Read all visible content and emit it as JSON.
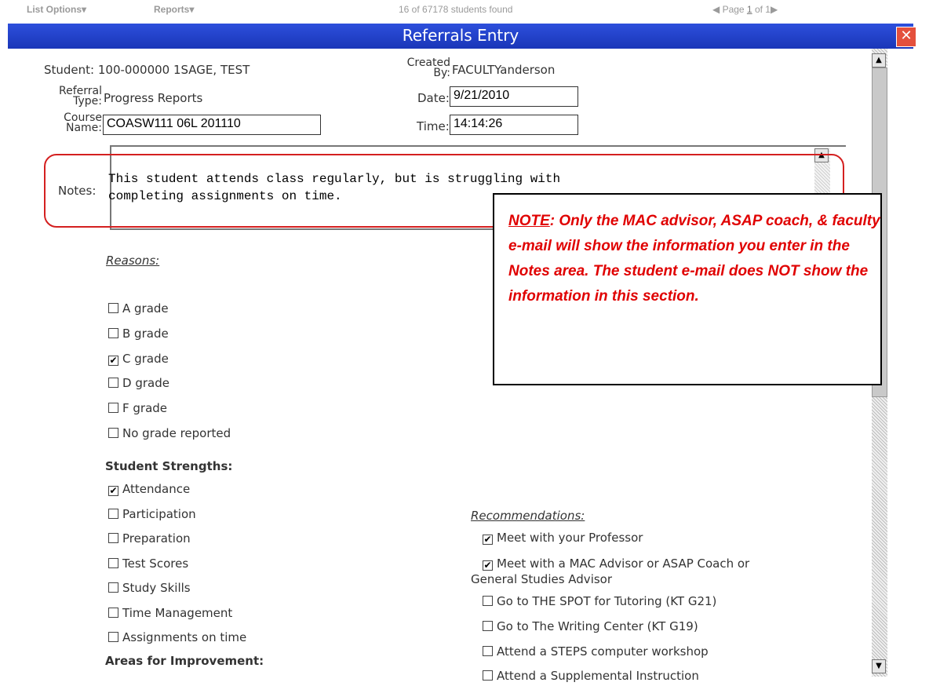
{
  "topbar": {
    "list_options": "List Options▾",
    "reports": "Reports▾",
    "found": "16 of 67178 students found",
    "page_prefix": "◀ Page ",
    "page_num": "1",
    "page_suffix": " of 1▶"
  },
  "window": {
    "title": "Referrals Entry",
    "close_glyph": "✕"
  },
  "form": {
    "student_label": "Student:",
    "student_value": "100-000000 1SAGE, TEST",
    "created_by_label_1": "Created",
    "created_by_label_2": "By:",
    "created_by_value": "FACULTYanderson",
    "referral_type_label_1": "Referral",
    "referral_type_label_2": "Type:",
    "referral_type_value": "Progress Reports",
    "date_label": "Date:",
    "date_value": "9/21/2010",
    "course_name_label_1": "Course",
    "course_name_label_2": "Name:",
    "course_name_value": "COASW111 06L 201110",
    "time_label": "Time:",
    "time_value": "14:14:26",
    "notes_label": "Notes:",
    "notes_value": "This student attends class regularly, but is struggling with\ncompleting assignments on time."
  },
  "reasons": {
    "heading": "Reasons:",
    "items": [
      {
        "label": "A grade",
        "checked": false
      },
      {
        "label": "B grade",
        "checked": false
      },
      {
        "label": "C grade",
        "checked": true
      },
      {
        "label": "D grade",
        "checked": false
      },
      {
        "label": "F grade",
        "checked": false
      },
      {
        "label": "No grade reported",
        "checked": false
      }
    ]
  },
  "strengths": {
    "heading": "Student Strengths:",
    "items": [
      {
        "label": "Attendance",
        "checked": true
      },
      {
        "label": "Participation",
        "checked": false
      },
      {
        "label": "Preparation",
        "checked": false
      },
      {
        "label": "Test Scores",
        "checked": false
      },
      {
        "label": "Study Skills",
        "checked": false
      },
      {
        "label": "Time Management",
        "checked": false
      },
      {
        "label": "Assignments on time",
        "checked": false
      }
    ]
  },
  "improvement": {
    "heading": "Areas for Improvement:"
  },
  "recommendations": {
    "heading": "Recommendations:",
    "items": [
      {
        "label": "Meet with your Professor",
        "checked": true
      },
      {
        "label": "Meet with a MAC Advisor or ASAP Coach or",
        "checked": true
      },
      {
        "label": "General Studies Advisor",
        "checked": null
      },
      {
        "label": "Go to THE SPOT for Tutoring (KT G21)",
        "checked": false
      },
      {
        "label": "Go to The Writing Center (KT G19)",
        "checked": false
      },
      {
        "label": "Attend a STEPS computer workshop",
        "checked": false
      },
      {
        "label": "Attend a Supplemental Instruction",
        "checked": false
      }
    ]
  },
  "callout": {
    "note_word": "NOTE",
    "text": ":  Only the MAC advisor, ASAP coach, & faculty e-mail will show the information you enter in the Notes area.  The student e-mail does NOT show the information in this section."
  },
  "check_glyph": "✔"
}
